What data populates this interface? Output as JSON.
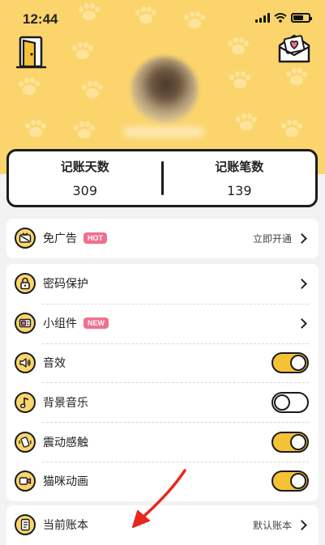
{
  "status_bar": {
    "time": "12:44"
  },
  "stats": {
    "days_label": "记账天数",
    "days_value": "309",
    "entries_label": "记账笔数",
    "entries_value": "139"
  },
  "ad_card": {
    "label": "免广告",
    "badge": "HOT",
    "action": "立即开通",
    "icon": "no-ads-tv-icon"
  },
  "settings": {
    "password": {
      "label": "密码保护",
      "icon": "lock-icon"
    },
    "widget": {
      "label": "小组件",
      "badge": "NEW",
      "icon": "widget-icon"
    },
    "sound": {
      "label": "音效",
      "icon": "speaker-icon",
      "enabled": true
    },
    "bgm": {
      "label": "背景音乐",
      "icon": "music-note-icon",
      "enabled": false
    },
    "vibration": {
      "label": "震动感触",
      "icon": "vibration-icon",
      "enabled": true
    },
    "cat_animation": {
      "label": "猫咪动画",
      "icon": "video-icon",
      "enabled": true
    }
  },
  "ledger": {
    "label": "当前账本",
    "value": "默认账本",
    "icon": "notebook-icon"
  },
  "colors": {
    "header_yellow": "#fbd56c",
    "toggle_on": "#f5c236",
    "badge_pink": "#f26f8e",
    "annotation_red": "#e8261c"
  }
}
